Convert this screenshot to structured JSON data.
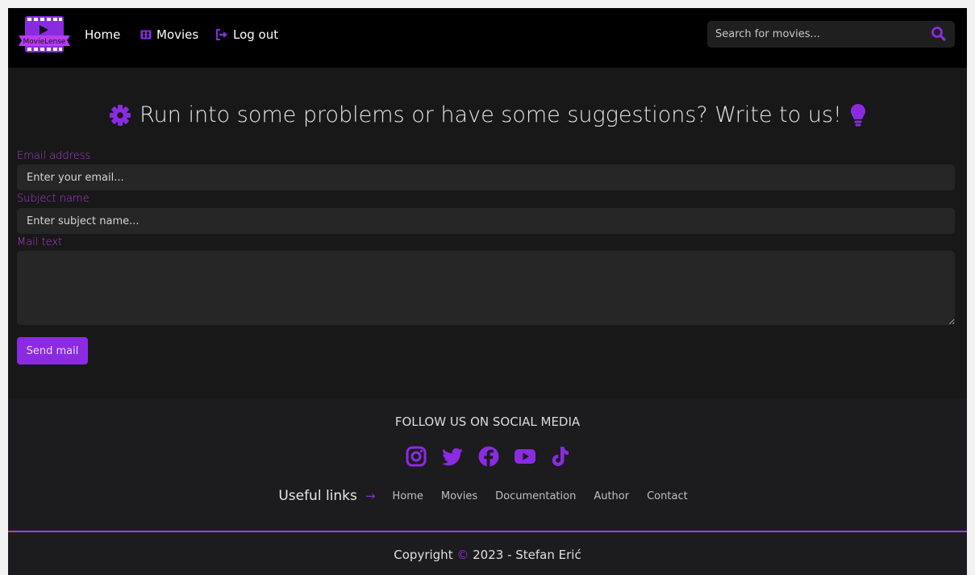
{
  "brand": {
    "logo_text": "MovieLense",
    "logo_color": "#8a2be2"
  },
  "nav": {
    "home": "Home",
    "movies": "Movies",
    "logout": "Log out"
  },
  "search": {
    "placeholder": "Search for movies...",
    "icon": "search-icon"
  },
  "headline": {
    "text": "Run into some problems or have some suggestions? Write to us!",
    "icon_left": "gear-icon",
    "icon_right": "lightbulb-icon"
  },
  "form": {
    "email_label": "Email address",
    "email_placeholder": "Enter your email...",
    "subject_label": "Subject name",
    "subject_placeholder": "Enter subject name...",
    "text_label": "Mail text",
    "text_value": "",
    "send_label": "Send mail"
  },
  "footer": {
    "follow": "FOLLOW US ON SOCIAL MEDIA",
    "socials": [
      "instagram-icon",
      "twitter-icon",
      "facebook-icon",
      "youtube-icon",
      "tiktok-icon"
    ],
    "useful_title": "Useful links",
    "useful_arrow": "→",
    "links": [
      "Home",
      "Movies",
      "Documentation",
      "Author",
      "Contact"
    ],
    "copyright_before": "Copyright",
    "copyright_symbol": "©",
    "copyright_after": "2023 - Stefan Erić"
  },
  "colors": {
    "accent": "#8a2be2",
    "label": "#b23dd9",
    "background": "#181818"
  }
}
